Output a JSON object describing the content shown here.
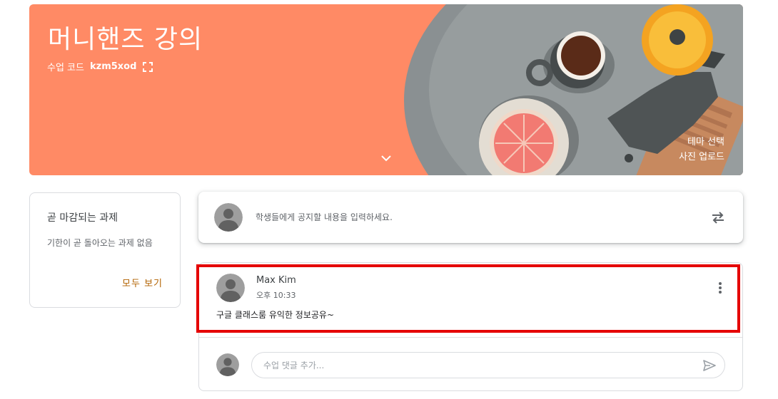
{
  "banner": {
    "title": "머니핸즈 강의",
    "class_code_label": "수업 코드",
    "class_code": "kzm5xod",
    "select_theme": "테마 선택",
    "upload_photo": "사진 업로드",
    "color": "#ff8a65"
  },
  "upcoming": {
    "title": "곧 마감되는 과제",
    "empty_text": "기한이 곧 돌아오는 과제 없음",
    "view_all": "모두 보기",
    "link_color": "#b26200"
  },
  "announce": {
    "placeholder": "학생들에게 공지할 내용을 입력하세요."
  },
  "post": {
    "author": "Max Kim",
    "time": "오후 10:33",
    "body": "구글 클래스룸 유익한 정보공유~",
    "comment_placeholder": "수업 댓글 추가...",
    "highlight_color": "#e50000"
  },
  "icons": {
    "fullscreen": "fullscreen-icon",
    "expand": "chevron-down-icon",
    "repost": "repost-icon",
    "more": "more-vert-icon",
    "send": "send-icon",
    "avatar": "person-avatar-icon"
  }
}
